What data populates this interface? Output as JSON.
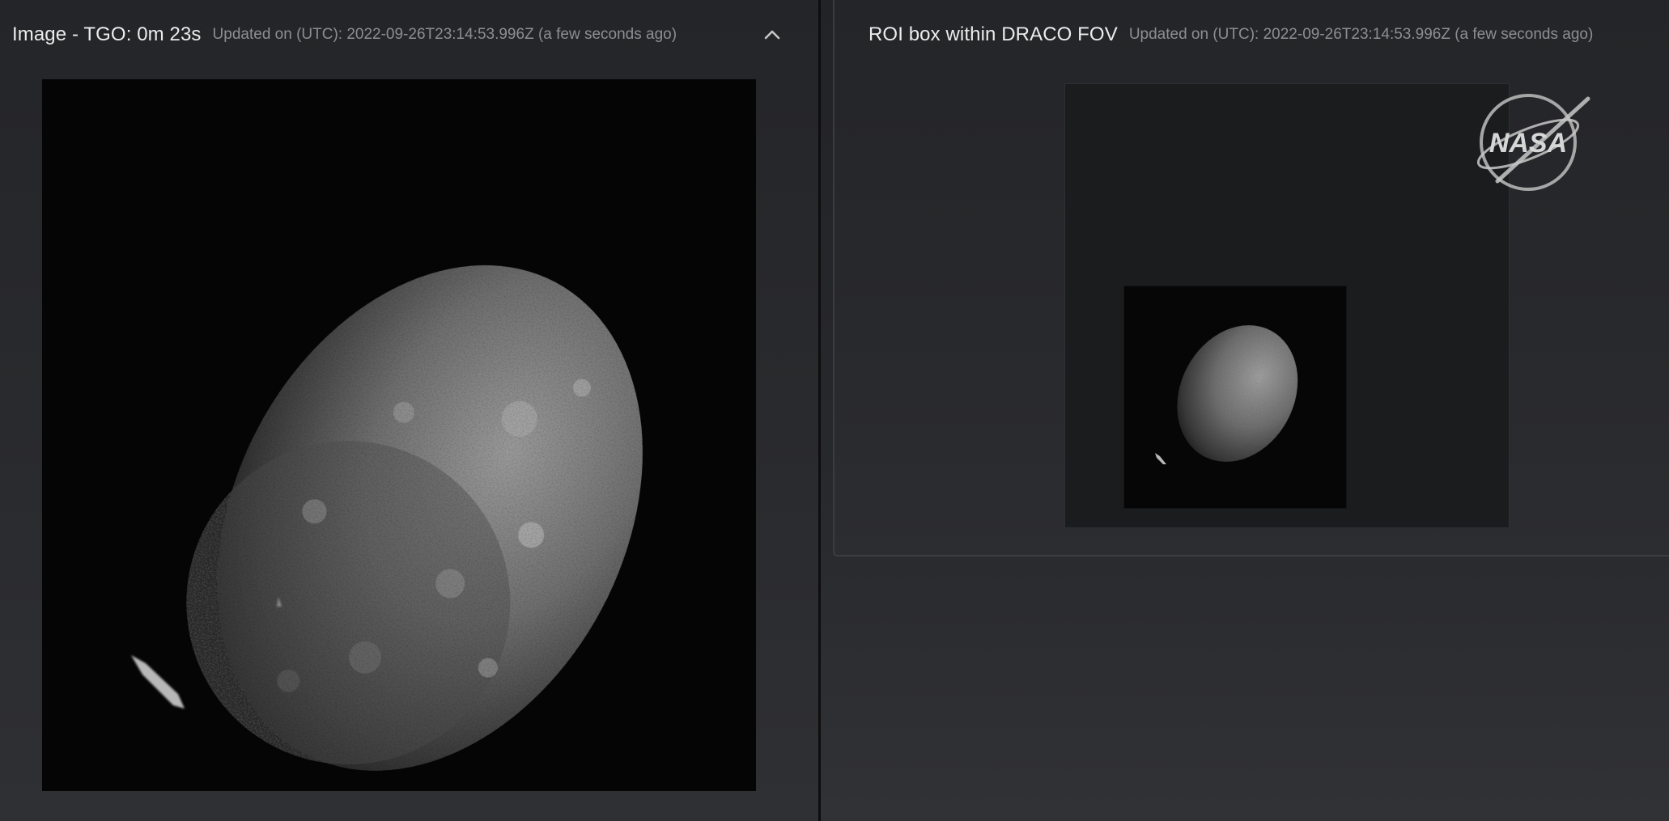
{
  "left_panel": {
    "title": "Image - TGO: 0m 23s",
    "updated": "Updated on (UTC): 2022-09-26T23:14:53.996Z (a few seconds ago)",
    "collapse_icon": "chevron-up-icon"
  },
  "right_panel": {
    "title": "ROI box within DRACO FOV",
    "updated": "Updated on (UTC): 2022-09-26T23:14:53.996Z (a few seconds ago)"
  },
  "watermark": {
    "text": "NASA",
    "icon": "nasa-meatball-logo"
  },
  "colors": {
    "background": "#26272a",
    "panel": "#28292c",
    "image_black": "#050505",
    "title_text": "#ececec",
    "meta_text": "#8d8e91"
  }
}
